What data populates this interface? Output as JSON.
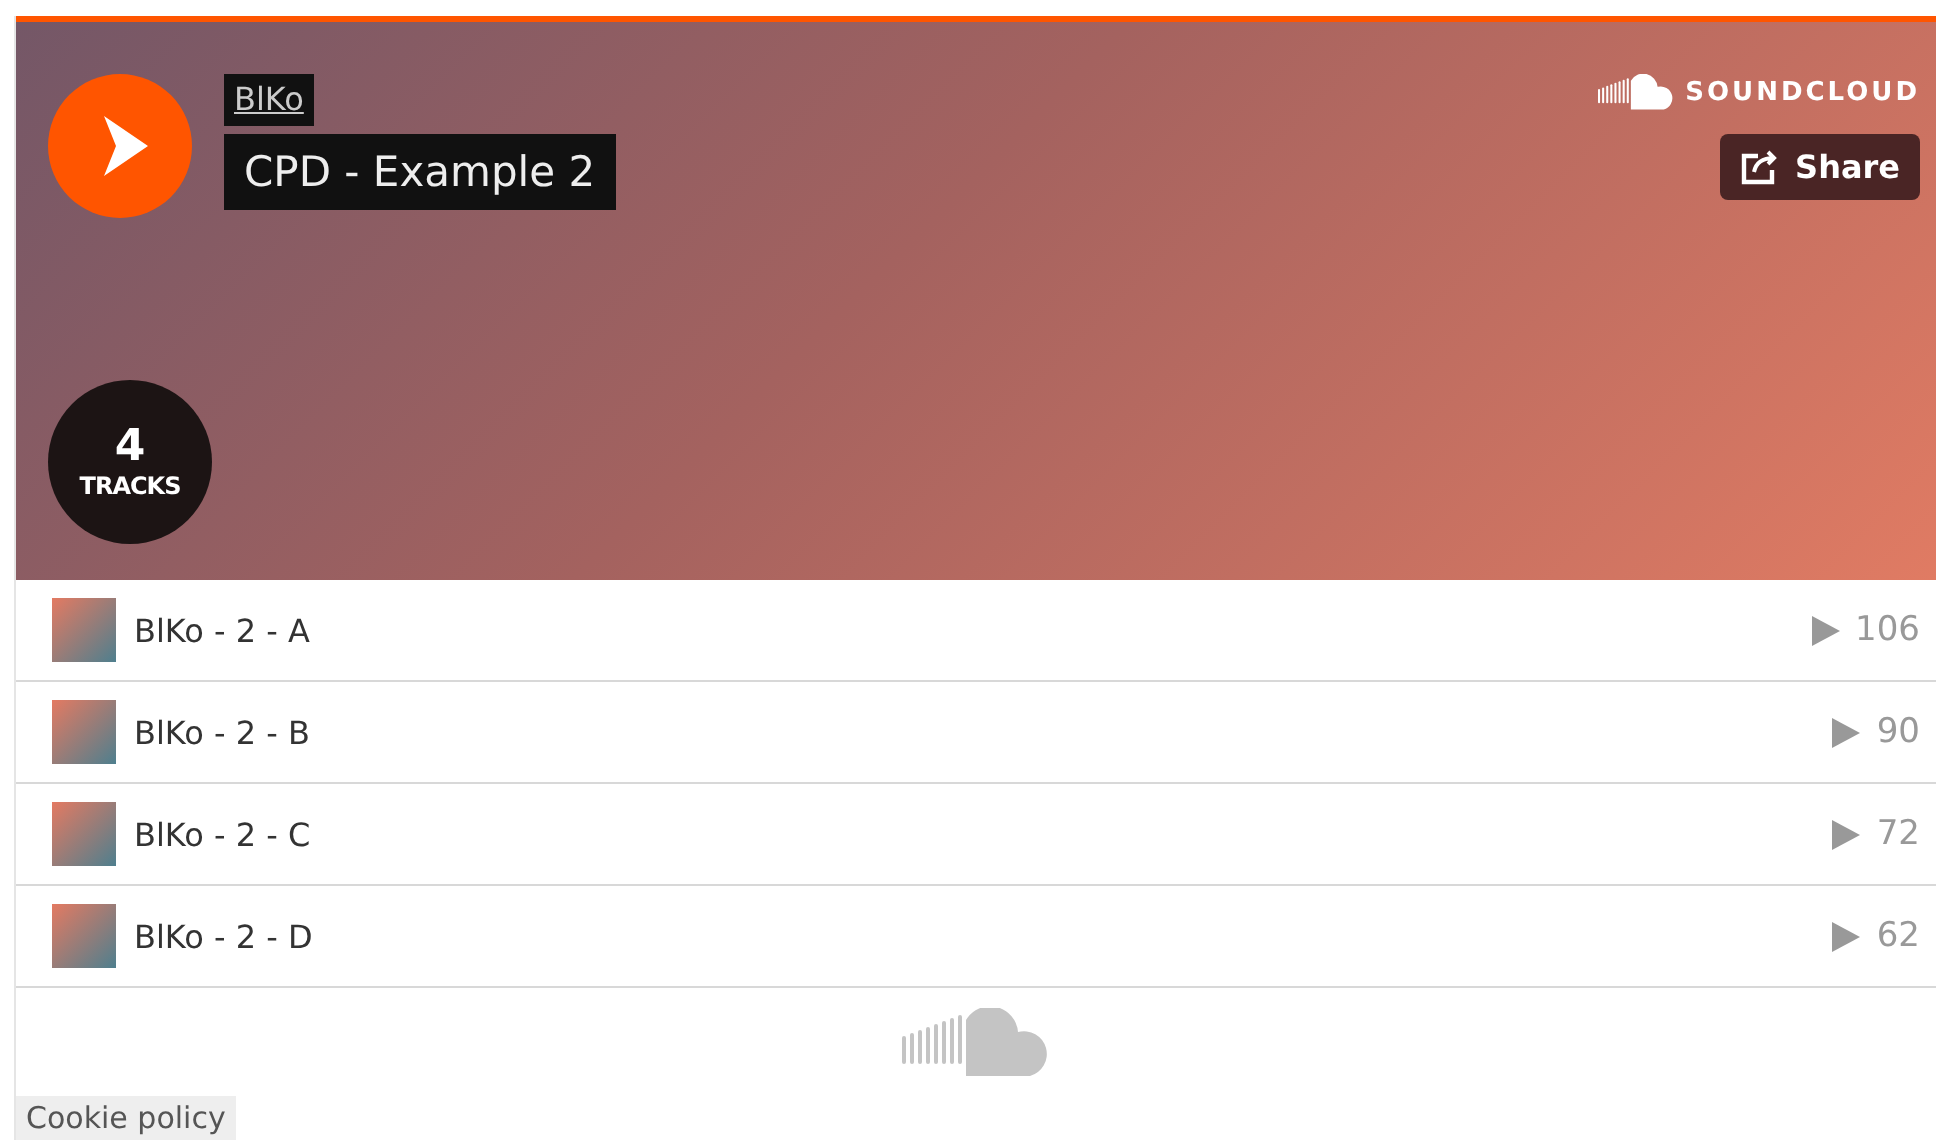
{
  "header": {
    "artist": "BlKo",
    "title": "CPD - Example 2",
    "brand": "SOUNDCLOUD",
    "share_button": "Share",
    "track_count": "4",
    "track_count_label": "TRACKS"
  },
  "tracks": [
    {
      "title": "BlKo - 2 - A",
      "plays": "106"
    },
    {
      "title": "BlKo - 2 - B",
      "plays": "90"
    },
    {
      "title": "BlKo - 2 - C",
      "plays": "72"
    },
    {
      "title": "BlKo - 2 - D",
      "plays": "62"
    }
  ],
  "footer": {
    "cookie_link": "Cookie policy"
  }
}
